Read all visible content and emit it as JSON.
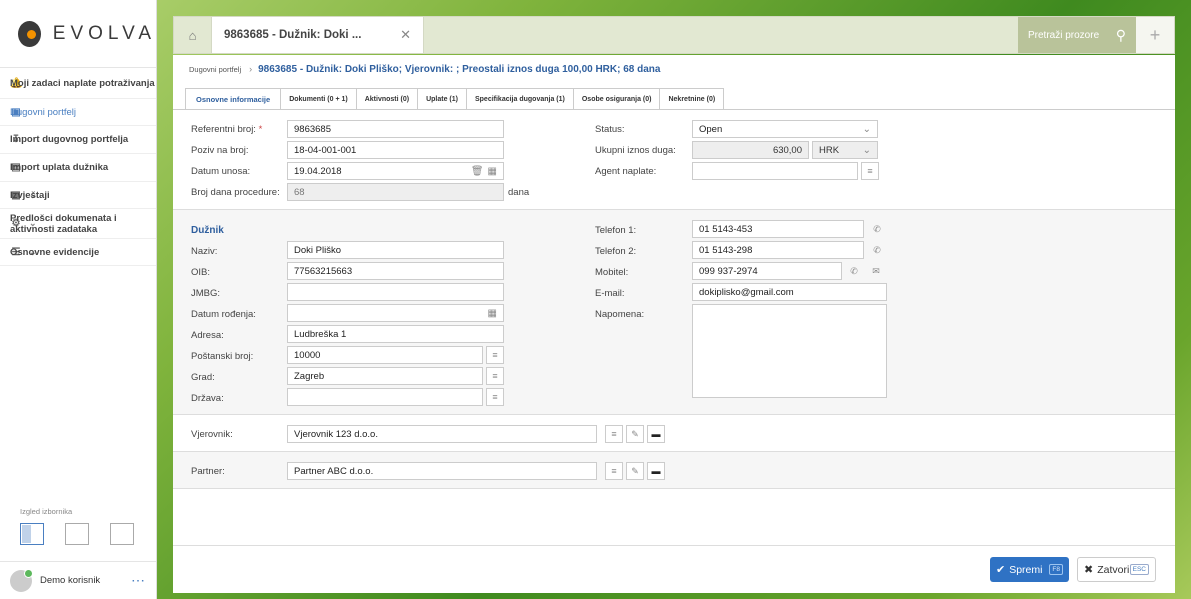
{
  "brand": {
    "name": "EVOLVA"
  },
  "sidebar": {
    "items": [
      {
        "label": "Moji zadaci naplate potraživanja",
        "icon": "bell-icon",
        "active": false,
        "has_chevron": false
      },
      {
        "label": "Dugovni portfelj",
        "icon": "briefcase-icon",
        "active": true,
        "has_chevron": false
      },
      {
        "label": "Import dugovnog portfelja",
        "icon": "download-icon",
        "active": false,
        "has_chevron": false
      },
      {
        "label": "Import uplata dužnika",
        "icon": "money-icon",
        "active": false,
        "has_chevron": false
      },
      {
        "label": "Izvještaji",
        "icon": "bar-chart-icon",
        "active": false,
        "has_chevron": true
      },
      {
        "label": "Predlošci dokumenata i aktivnosti zadataka",
        "icon": "gear-icon",
        "active": false,
        "has_chevron": true
      },
      {
        "label": "Osnovne evidencije",
        "icon": "list-icon",
        "active": false,
        "has_chevron": true
      }
    ],
    "layout_label": "Izgled izbornika",
    "user_name": "Demo korisnik"
  },
  "topbar": {
    "window_tab_title": "9863685 - Dužnik: Doki ...",
    "search_placeholder": "Pretraži prozore"
  },
  "breadcrumb": {
    "root": "Dugovni portfelj",
    "title": "9863685 - Dužnik: Doki Pliško; Vjerovnik: ; Preostali iznos duga 100,00 HRK; 68 dana"
  },
  "tabs": [
    {
      "label": "Osnovne informacije",
      "active": true
    },
    {
      "label": "Dokumenti (0 + 1)",
      "active": false
    },
    {
      "label": "Aktivnosti (0)",
      "active": false
    },
    {
      "label": "Uplate (1)",
      "active": false
    },
    {
      "label": "Specifikacija dugovanja (1)",
      "active": false
    },
    {
      "label": "Osobe osiguranja (0)",
      "active": false
    },
    {
      "label": "Nekretnine (0)",
      "active": false
    }
  ],
  "general": {
    "ref_label": "Referentni broj:",
    "ref_required": "*",
    "ref_value": "9863685",
    "poziv_label": "Poziv na broj:",
    "poziv_value": "18-04-001-001",
    "datum_label": "Datum unosa:",
    "datum_value": "19.04.2018",
    "dana_label": "Broj dana procedure:",
    "dana_value": "68",
    "dana_unit": "dana",
    "status_label": "Status:",
    "status_value": "Open",
    "iznos_label": "Ukupni iznos duga:",
    "iznos_value": "630,00",
    "currency_value": "HRK",
    "agent_label": "Agent naplate:",
    "agent_value": ""
  },
  "debtor": {
    "section_title": "Dužnik",
    "naziv_label": "Naziv:",
    "naziv_value": "Doki Pliško",
    "oib_label": "OIB:",
    "oib_value": "77563215663",
    "jmbg_label": "JMBG:",
    "jmbg_value": "",
    "rodjenje_label": "Datum rođenja:",
    "rodjenje_value": "",
    "adresa_label": "Adresa:",
    "adresa_value": "Ludbreška 1",
    "postanski_label": "Poštanski broj:",
    "postanski_value": "10000",
    "grad_label": "Grad:",
    "grad_value": "Zagreb",
    "drzava_label": "Država:",
    "drzava_value": "",
    "tel1_label": "Telefon 1:",
    "tel1_value": "01 5143-453",
    "tel2_label": "Telefon 2:",
    "tel2_value": "01 5143-298",
    "mob_label": "Mobitel:",
    "mob_value": "099 937-2974",
    "email_label": "E-mail:",
    "email_value": "dokiplisko@gmail.com",
    "napomena_label": "Napomena:",
    "napomena_value": ""
  },
  "creditor": {
    "label": "Vjerovnik:",
    "value": "Vjerovnik 123 d.o.o."
  },
  "partner": {
    "label": "Partner:",
    "value": "Partner ABC d.o.o."
  },
  "footer": {
    "save_label": "Spremi",
    "save_key": "F8",
    "close_label": "Zatvori",
    "close_key": "ESC"
  },
  "colors": {
    "accent": "#2f72c4",
    "title_blue": "#2f5f9e",
    "active_green": "#5cb85c"
  }
}
